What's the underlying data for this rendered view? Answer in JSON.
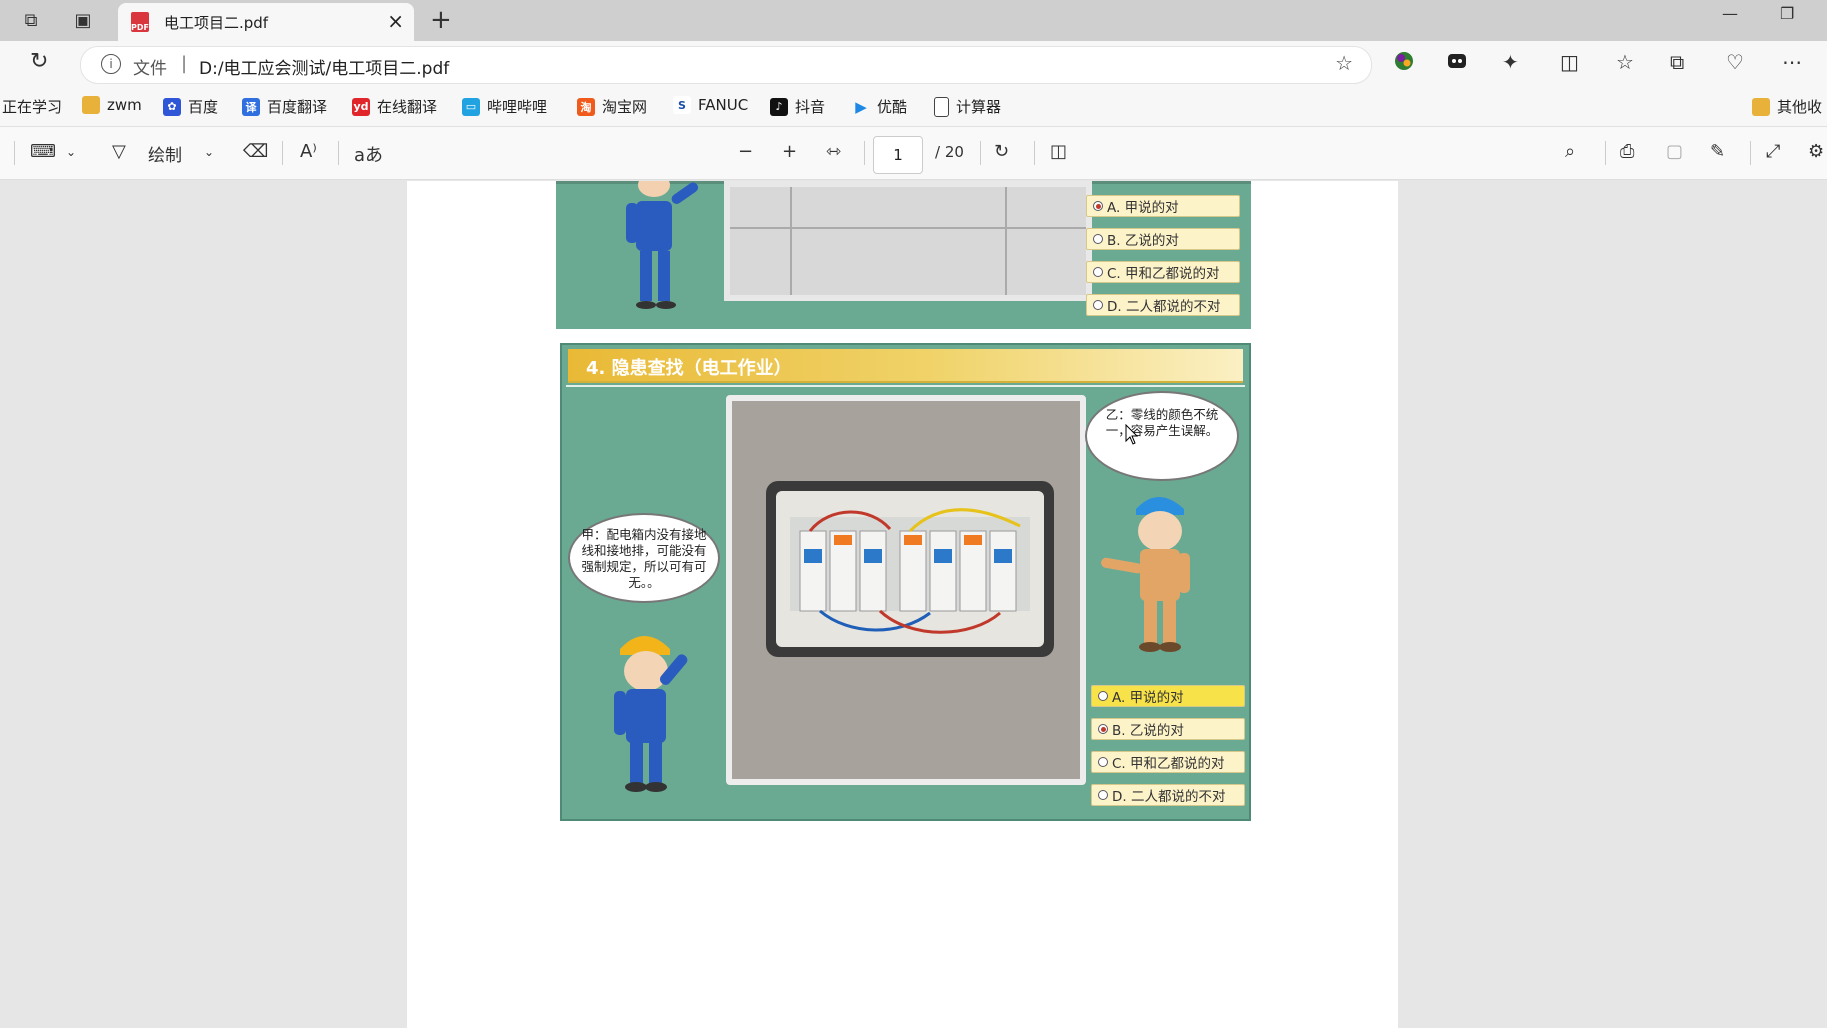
{
  "browser": {
    "tab_title": "电工项目二.pdf",
    "address": {
      "file_label": "文件",
      "separator": "|",
      "url": "D:/电工应会测试/电工项目二.pdf"
    },
    "bookmarks": [
      {
        "label": "正在学习",
        "icon": "none"
      },
      {
        "label": "zwm",
        "icon": "folder-icon"
      },
      {
        "label": "百度",
        "icon": "baidu-icon"
      },
      {
        "label": "百度翻译",
        "icon": "translate-icon"
      },
      {
        "label": "在线翻译",
        "icon": "youdao-icon"
      },
      {
        "label": "哔哩哔哩",
        "icon": "bilibili-icon"
      },
      {
        "label": "淘宝网",
        "icon": "taobao-icon"
      },
      {
        "label": "FANUC",
        "icon": "fanuc-icon"
      },
      {
        "label": "抖音",
        "icon": "douyin-icon"
      },
      {
        "label": "优酷",
        "icon": "youku-icon"
      },
      {
        "label": "计算器",
        "icon": "page-icon"
      },
      {
        "label": "其他收",
        "icon": "folder-icon"
      }
    ]
  },
  "pdf_toolbar": {
    "draw_label": "绘制",
    "text_icon": "aあ",
    "page_current": "1",
    "page_total": "/ 20"
  },
  "document": {
    "prev_slide_options": [
      "A. 甲说的对",
      "B. 乙说的对",
      "C. 甲和乙都说的对",
      "D. 二人都说的不对"
    ],
    "slide": {
      "title": "4.  隐患查找（电工作业）",
      "bubble_left": "甲：配电箱内没有接地线和接地排，可能没有强制规定，所以可有可无。。",
      "bubble_right": "乙：零线的颜色不统一，容易产生误解。",
      "options": [
        {
          "label": "A. 甲说的对",
          "selected": false
        },
        {
          "label": "B. 乙说的对",
          "selected": true
        },
        {
          "label": "C. 甲和乙都说的对",
          "selected": false
        },
        {
          "label": "D. 二人都说的不对",
          "selected": false
        }
      ]
    }
  },
  "colors": {
    "slide_bg": "#6aaa93",
    "title_bar": "#e9b936",
    "option_bg": "#fdf3c8",
    "selected_radio": "#c0392b"
  }
}
